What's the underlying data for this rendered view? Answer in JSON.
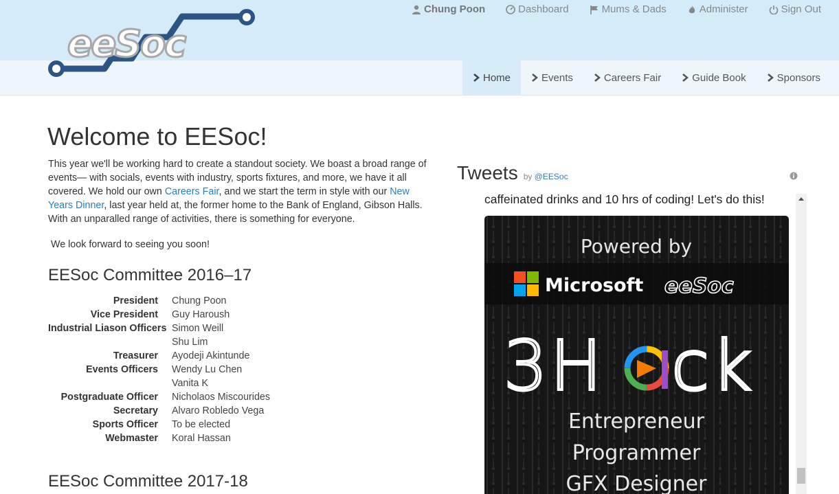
{
  "header": {
    "logo_text": "eeSoc",
    "user_links": [
      {
        "label": "Chung Poon",
        "icon": "user-icon"
      },
      {
        "label": "Dashboard",
        "icon": "dashboard-icon"
      },
      {
        "label": "Mums & Dads",
        "icon": "flag-icon"
      },
      {
        "label": "Administer",
        "icon": "fire-icon"
      },
      {
        "label": "Sign Out",
        "icon": "power-icon"
      }
    ],
    "nav": [
      {
        "label": "Home",
        "active": true
      },
      {
        "label": "Events",
        "active": false
      },
      {
        "label": "Careers Fair",
        "active": false
      },
      {
        "label": "Guide Book",
        "active": false
      },
      {
        "label": "Sponsors",
        "active": false
      }
    ]
  },
  "main": {
    "title": "Welcome to EESoc!",
    "intro": {
      "part1": "This year we'll be working hard to create a standout society. We boast a broad range of events— with socials, events with industry, sports fixtures, and more, we have it all covered. We hold our own ",
      "link1": "Careers Fair",
      "part2": ", and we start the term in style with our ",
      "link2": "New Years Dinner",
      "part3": ", last year held at, the former home to the Bank of England, Gibson Halls. With an unparalled range of activities, there is something for everyone."
    },
    "outro": " We look forward to seeing you soon!",
    "committee_title": "EESoc Committee 2016–17",
    "committee": [
      {
        "role": "President",
        "name": "Chung Poon"
      },
      {
        "role": "Vice President",
        "name": "Guy Haroush"
      },
      {
        "role": "Industrial Liason Officers",
        "name": "Simon Weill"
      },
      {
        "role": "",
        "name": "Shu Lim"
      },
      {
        "role": "Treasurer",
        "name": "Ayodeji Akintunde"
      },
      {
        "role": "Events Officers",
        "name": "Wendy Lu Chen"
      },
      {
        "role": "",
        "name": "Vanita K"
      },
      {
        "role": "Postgraduate Officer",
        "name": "Nicholaos Miscourides"
      },
      {
        "role": "Secretary",
        "name": "Alvaro Robledo Vega"
      },
      {
        "role": "Sports Officer",
        "name": "To be elected"
      },
      {
        "role": "Webmaster",
        "name": "Koral Hassan"
      }
    ],
    "next_committee_title": "EESoc Committee 2017-18"
  },
  "tweets": {
    "title": "Tweets",
    "by": "by",
    "handle": "@EESoc",
    "tweet_text": "caffeinated drinks and 10 hrs of coding! Let's do this!",
    "image": {
      "powered_by": "Powered by",
      "microsoft": "Microsoft",
      "eesoc": "eeSoc",
      "hack_title_left": "3H",
      "hack_title_right": "ck",
      "lines": [
        "Entrepreneur",
        "Programmer",
        "GFX Designer"
      ]
    }
  }
}
